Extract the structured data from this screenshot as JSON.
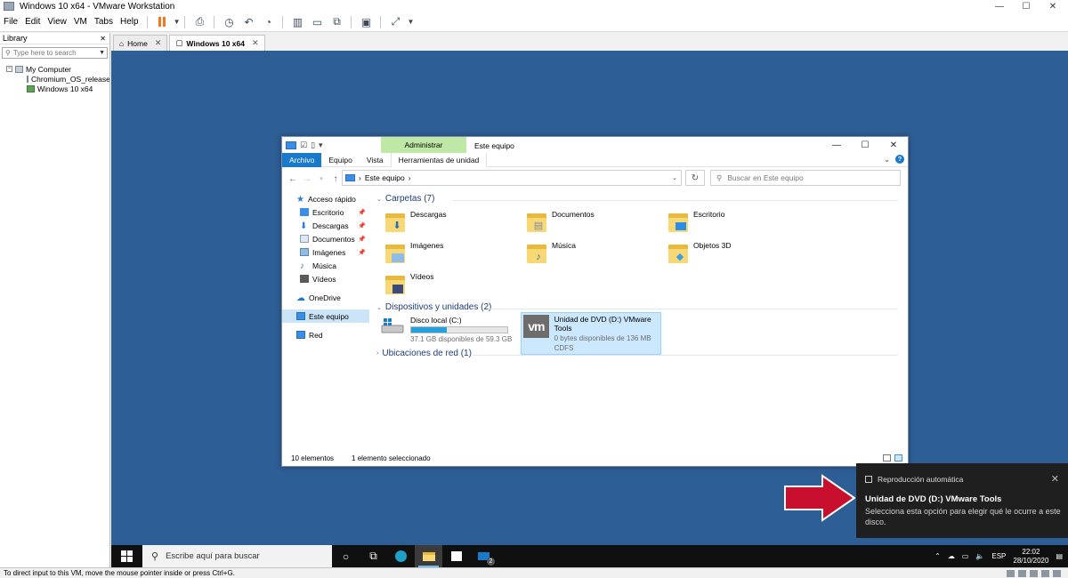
{
  "host": {
    "window_title": "Windows 10 x64 - VMware Workstation",
    "menu": [
      "File",
      "Edit",
      "View",
      "VM",
      "Tabs",
      "Help"
    ],
    "library": {
      "header": "Library",
      "search_placeholder": "Type here to search",
      "tree": [
        {
          "label": "My Computer"
        },
        {
          "label": "Chromium_OS_release-l"
        },
        {
          "label": "Windows 10 x64"
        }
      ]
    },
    "tabs": [
      {
        "label": "Home"
      },
      {
        "label": "Windows 10 x64"
      }
    ],
    "status_text": "To direct input to this VM, move the mouse pointer inside or press Ctrl+G."
  },
  "explorer": {
    "title": "Este equipo",
    "manage_tab": "Administrar",
    "ribbon_tabs": [
      "Archivo",
      "Equipo",
      "Vista",
      "Herramientas de unidad"
    ],
    "address": "Este equipo",
    "search_placeholder": "Buscar en Este equipo",
    "nav": {
      "quick_access": "Acceso rápido",
      "items": [
        "Escritorio",
        "Descargas",
        "Documentos",
        "Imágenes",
        "Música",
        "Vídeos"
      ],
      "onedrive": "OneDrive",
      "this_pc": "Este equipo",
      "network": "Red"
    },
    "groups": {
      "folders_header": "Carpetas (7)",
      "devices_header": "Dispositivos y unidades (2)",
      "network_header": "Ubicaciones de red (1)"
    },
    "folders": [
      "Descargas",
      "Documentos",
      "Escritorio",
      "Imágenes",
      "Música",
      "Objetos 3D",
      "Vídeos"
    ],
    "drives": [
      {
        "name": "Disco local (C:)",
        "detail": "37.1 GB disponibles de 59.3 GB",
        "used_fraction": 0.37
      },
      {
        "name": "Unidad de DVD (D:) VMware Tools",
        "detail": "0 bytes disponibles de 136 MB",
        "fs": "CDFS",
        "logo": "vm"
      }
    ],
    "status": {
      "count": "10 elementos",
      "selected": "1 elemento seleccionado"
    }
  },
  "toast": {
    "app": "Reproducción automática",
    "title": "Unidad de DVD (D:) VMware Tools",
    "body": "Selecciona esta opción para elegir qué le ocurre a este disco."
  },
  "taskbar": {
    "search_placeholder": "Escribe aquí para buscar",
    "language": "ESP",
    "time": "22:02",
    "date": "28/10/2020",
    "mail_badge": "2"
  },
  "colors": {
    "desktop": "#2e5e96",
    "accent": "#1979ca",
    "arrow": "#c8102e",
    "manage_tab": "#bfe8a6"
  }
}
